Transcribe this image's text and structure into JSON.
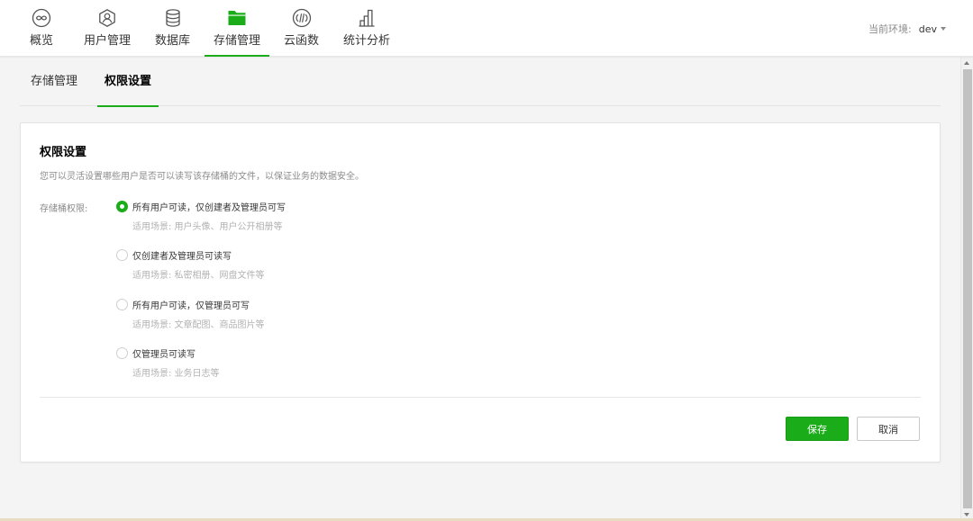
{
  "nav": {
    "items": [
      {
        "label": "概览",
        "icon": "overview-icon"
      },
      {
        "label": "用户管理",
        "icon": "user-icon"
      },
      {
        "label": "数据库",
        "icon": "database-icon"
      },
      {
        "label": "存储管理",
        "icon": "folder-icon",
        "active": true
      },
      {
        "label": "云函数",
        "icon": "function-icon"
      },
      {
        "label": "统计分析",
        "icon": "chart-icon"
      }
    ],
    "env_label": "当前环境:",
    "env_value": "dev"
  },
  "subtabs": [
    {
      "label": "存储管理"
    },
    {
      "label": "权限设置",
      "active": true
    }
  ],
  "card": {
    "title": "权限设置",
    "description": "您可以灵活设置哪些用户是否可以读写该存储桶的文件，以保证业务的数据安全。",
    "field_label": "存储桶权限:",
    "options": [
      {
        "title": "所有用户可读，仅创建者及管理员可写",
        "hint": "适用场景: 用户头像、用户公开相册等",
        "checked": true
      },
      {
        "title": "仅创建者及管理员可读写",
        "hint": "适用场景: 私密相册、网盘文件等",
        "checked": false
      },
      {
        "title": "所有用户可读，仅管理员可写",
        "hint": "适用场景: 文章配图、商品图片等",
        "checked": false
      },
      {
        "title": "仅管理员可读写",
        "hint": "适用场景: 业务日志等",
        "checked": false
      }
    ],
    "save_label": "保存",
    "cancel_label": "取消"
  },
  "colors": {
    "accent": "#1aad19",
    "text_primary": "#353535",
    "text_secondary": "#8a8a8a",
    "text_hint": "#b2b2b2"
  }
}
